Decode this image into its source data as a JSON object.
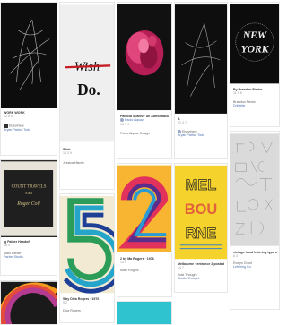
{
  "grid": {
    "cards": [
      {
        "id": "c1",
        "title": "WORK WORK",
        "stats": "12  8  6",
        "author": "Elsewhere",
        "author_line": "Bryan Patrick Todd"
      },
      {
        "id": "c2",
        "title": "Wish",
        "stats": "14  3  9",
        "author": "Jessica Hische"
      },
      {
        "id": "c3",
        "title": "Patricia Suarez · un Adirondack",
        "stats": "18  9  4",
        "author": "Paolo Alquaz",
        "author_line": "Paolo Alquaz Design"
      },
      {
        "id": "c4",
        "title": "A",
        "stats": "22  4  7",
        "author": "Elsewhere",
        "author_line": "Bryan Patrick Todd"
      },
      {
        "id": "c5",
        "title": "By Brandon Fiedor",
        "stats": "11  9  6",
        "author": "Brandon Fiedor",
        "author_line": "Dribbble"
      },
      {
        "id": "c6",
        "title": "Ig Father Handoff",
        "stats": "16  4",
        "author": "Mark Parker",
        "author_line": "Parker Studio"
      },
      {
        "id": "c7",
        "title": "5 by Diva Rogers · 1976",
        "stats": "9  2",
        "author": "Diva Rogers"
      },
      {
        "id": "c8",
        "title": "2 by Ma Rogers · 1976",
        "stats": "13  5",
        "author": "Mark Rogers"
      },
      {
        "id": "c9",
        "title": "Melbourne · entrance 2 posted Jolie Thought",
        "stats": "14  7",
        "author": "Jolie Thought",
        "author_line": "Studio Thought"
      },
      {
        "id": "c10",
        "title": "vintage hand lettering type sheet",
        "stats": "8  3",
        "author": "Evelyn Grant",
        "author_line": "Lettering Co."
      }
    ],
    "art": {
      "c2_line1": "Wish",
      "c2_line2": "Do.",
      "c5_lines": [
        "NEW",
        "YORK"
      ],
      "c6_lines": [
        "COUNT TRAVELS",
        "AND",
        "Roger Coil"
      ],
      "c9_lines": [
        "MEL",
        "BOU",
        "RNE"
      ]
    }
  },
  "colors": {
    "accent_blue": "#4a6fb0",
    "red_stroke": "#c41e24",
    "yellow": "#f6d32c",
    "dark": "#111111"
  }
}
